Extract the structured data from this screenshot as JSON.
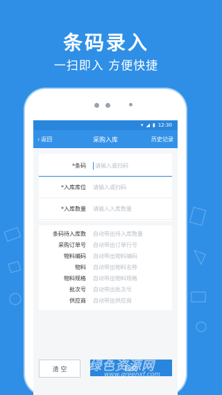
{
  "promo": {
    "headline": "条码录入",
    "subline": "一扫即入  方便快捷"
  },
  "statusbar": {
    "time": "12:30"
  },
  "navbar": {
    "back_label": "返回",
    "title": "采购入库",
    "history_label": "历史记录"
  },
  "form": {
    "barcode": {
      "label": "*条码",
      "placeholder": "请输入或扫码"
    },
    "location": {
      "label": "*入库库位",
      "placeholder": "请输入或扫码"
    },
    "quantity": {
      "label": "*入库数量",
      "placeholder": "请输入入库数量"
    }
  },
  "info": [
    {
      "label": "条码待入库数",
      "value": "自动带出待入库数量"
    },
    {
      "label": "采购订单号",
      "value": "自动带出订单行号"
    },
    {
      "label": "物料编码",
      "value": "自动带出物料编码"
    },
    {
      "label": "物料",
      "value": "自动带出物料名称"
    },
    {
      "label": "物料规格",
      "value": "自动带出物料规格"
    },
    {
      "label": "批次号",
      "value": "自动带出批次号"
    },
    {
      "label": "供应商",
      "value": "自动带出供应商"
    }
  ],
  "buttons": {
    "clear": "清 空",
    "submit": "提交"
  },
  "watermark": {
    "brand": "绿色资源网",
    "url": "www.greenxf.com"
  },
  "colors": {
    "primary": "#2f8fe6",
    "nav": "#3392e8"
  }
}
